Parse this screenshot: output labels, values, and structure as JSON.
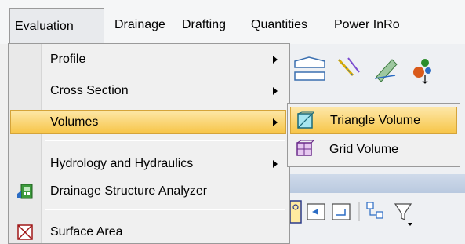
{
  "menubar": {
    "items": [
      "Evaluation",
      "Drainage",
      "Drafting",
      "Quantities",
      "Power InRo"
    ]
  },
  "menu": {
    "items": [
      {
        "label": "Profile",
        "submenu": true
      },
      {
        "label": "Cross Section",
        "submenu": true
      },
      {
        "label": "Volumes",
        "submenu": true,
        "highlighted": true
      },
      {
        "label": "Hydrology and Hydraulics",
        "submenu": true
      },
      {
        "label": "Drainage Structure Analyzer",
        "icon": "drainage-analyzer-icon"
      },
      {
        "label": "Surface Area",
        "icon": "surface-area-icon"
      }
    ]
  },
  "submenu": {
    "items": [
      {
        "label": "Triangle Volume",
        "icon": "triangle-volume-icon",
        "highlighted": true
      },
      {
        "label": "Grid Volume",
        "icon": "grid-volume-icon"
      }
    ]
  },
  "colors": {
    "highlight": "#f7c548",
    "highlight_border": "#d5a43a",
    "menu_bg": "#f0f0f0"
  }
}
